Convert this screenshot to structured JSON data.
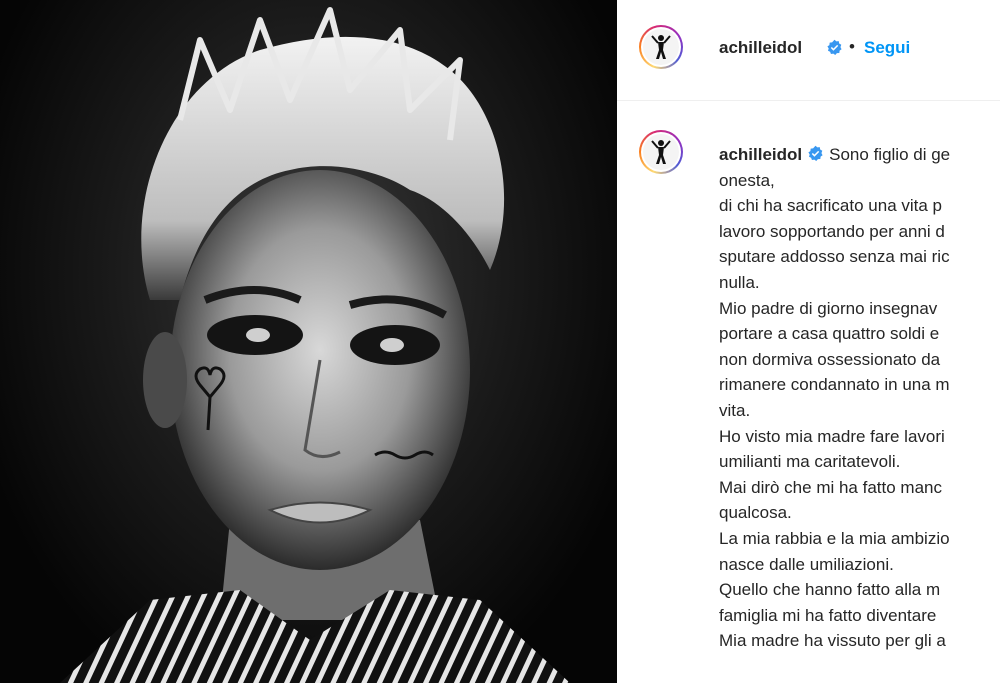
{
  "post": {
    "username": "achilleidol",
    "follow_label": "Segui",
    "separator": "•",
    "verified_icon": "verified-badge-icon"
  },
  "caption": {
    "username": "achilleidol",
    "lines": [
      "Sono figlio di ge",
      "onesta,",
      "di chi ha sacrificato una vita p",
      "lavoro sopportando per anni d",
      "sputare addosso senza mai ric",
      "nulla.",
      "Mio padre di giorno insegnav",
      "portare a casa quattro soldi e",
      "non dormiva ossessionato da",
      "rimanere condannato in una m",
      "vita.",
      "Ho visto mia madre fare lavori",
      "umilianti ma caritatevoli.",
      "Mai dirò che mi ha fatto manc",
      "qualcosa.",
      "La mia rabbia e la mia ambizio",
      "nasce dalle umiliazioni.",
      "Quello che hanno fatto alla m",
      "famiglia mi ha fatto diventare",
      "Mia madre ha vissuto per gli a"
    ]
  },
  "colors": {
    "accent": "#0095f6",
    "text": "#262626",
    "border": "#efefef"
  }
}
